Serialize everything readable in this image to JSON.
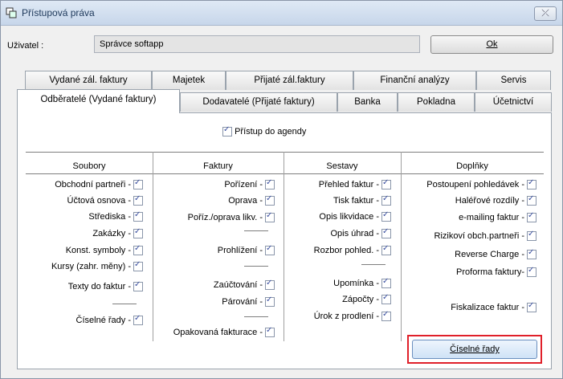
{
  "window": {
    "title": "Přístupová práva",
    "close_label": "⤫"
  },
  "user": {
    "label": "Uživatel :",
    "value": "Správce softapp"
  },
  "ok_button": {
    "label": "Ok"
  },
  "tabs_row1": [
    "Vydané zál. faktury",
    "Majetek",
    "Přijaté zál.faktury",
    "Finanční analýzy",
    "Servis"
  ],
  "tabs_row2": [
    "Odběratelé (Vydané faktury)",
    "Dodavatelé (Přijaté faktury)",
    "Banka",
    "Pokladna",
    "Účetnictví"
  ],
  "panel": {
    "access_label": "Přístup do agendy",
    "columns": [
      "Soubory",
      "Faktury",
      "Sestavy",
      "Doplňky"
    ],
    "soubory": [
      "Obchodní partneři -",
      "Účtová osnova -",
      "Střediska -",
      "Zakázky -",
      "Konst. symboly -",
      "Kursy (zahr. měny) -",
      "Texty do faktur -",
      "Číselné řady -"
    ],
    "faktury": [
      "Pořízení -",
      "Oprava -",
      "Poříz./oprava likv. -",
      "Prohlížení -",
      "Zaúčtování -",
      "Párování -",
      "Opakovaná fakturace -"
    ],
    "sestavy": [
      "Přehled faktur -",
      "Tisk faktur -",
      "Opis likvidace -",
      "Opis úhrad -",
      "Rozbor pohled. -",
      "Upomínka -",
      "Zápočty -",
      "Úrok z prodlení -"
    ],
    "doplnky": [
      "Postoupení pohledávek -",
      "Haléřové rozdíly -",
      "e-mailing faktur -",
      "Rizikoví obch.partneři -",
      "Reverse Charge -",
      "Proforma faktury-",
      "Fiskalizace faktur -"
    ],
    "ciselne_button": "Číselné řady"
  }
}
